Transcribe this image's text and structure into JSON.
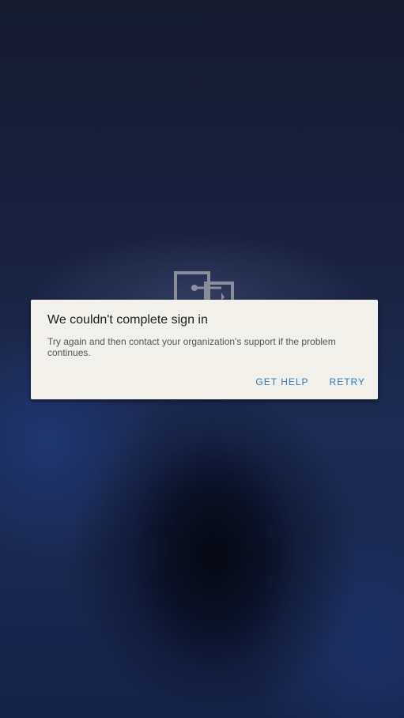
{
  "dialog": {
    "title": "We couldn't complete sign in",
    "message": "Try again and then contact your organization's support if the problem continues.",
    "buttons": {
      "get_help": "GET HELP",
      "retry": "RETRY"
    }
  },
  "colors": {
    "background": "#1b2240",
    "dialog_background": "#f1f0ea",
    "accent": "#2f7ab6"
  },
  "icons": {
    "app_icon": "sign-in-app-icon"
  }
}
